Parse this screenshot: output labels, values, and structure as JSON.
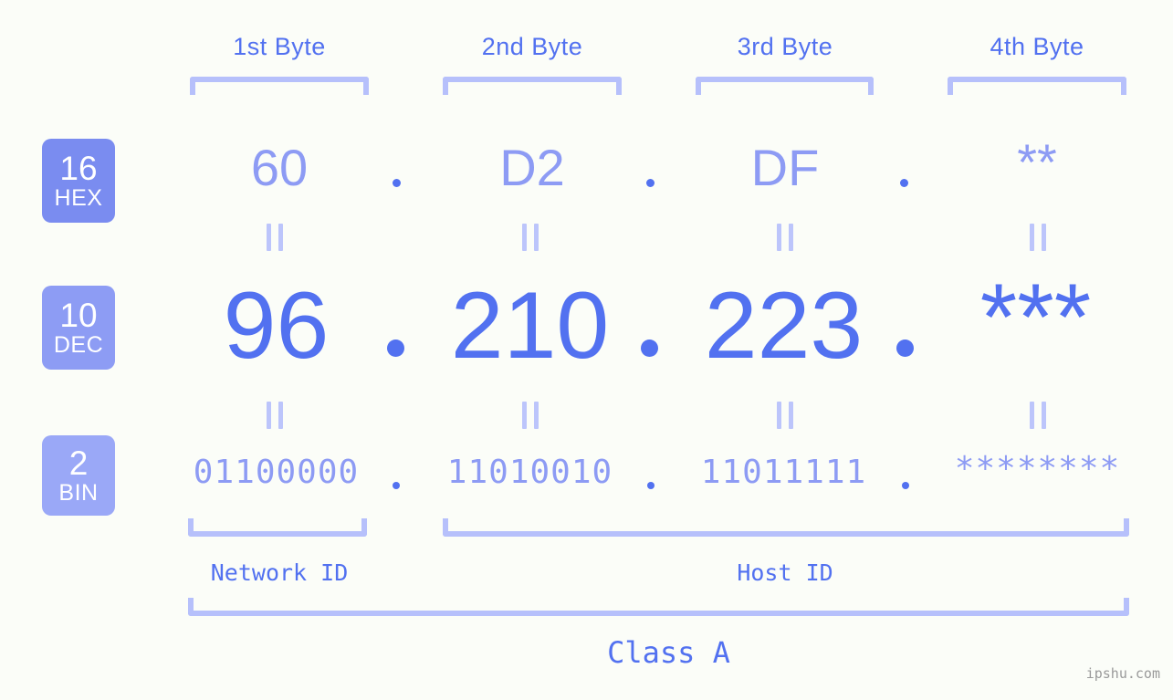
{
  "meta": {
    "watermark": "ipshu.com",
    "background_color": "#fbfdf8",
    "accent_color": "#5271f0",
    "light_accent_color": "#8d9bf4",
    "bracket_color": "#b6c0fb"
  },
  "byte_headers": [
    {
      "label": "1st Byte"
    },
    {
      "label": "2nd Byte"
    },
    {
      "label": "3rd Byte"
    },
    {
      "label": "4th Byte"
    }
  ],
  "bases": [
    {
      "number": "16",
      "name": "HEX",
      "color": "#7a8cf0"
    },
    {
      "number": "10",
      "name": "DEC",
      "color": "#8d9cf4"
    },
    {
      "number": "2",
      "name": "BIN",
      "color": "#9aa8f7"
    }
  ],
  "rows": {
    "hex": {
      "base_number": "16",
      "base_name": "HEX",
      "values": [
        "60",
        "D2",
        "DF",
        "**"
      ],
      "separator": "."
    },
    "dec": {
      "base_number": "10",
      "base_name": "DEC",
      "values": [
        "96",
        "210",
        "223",
        "***"
      ],
      "separator": "."
    },
    "bin": {
      "base_number": "2",
      "base_name": "BIN",
      "values": [
        "01100000",
        "11010010",
        "11011111",
        "********"
      ],
      "separator": "."
    }
  },
  "equivalence_symbol": "=",
  "segments": {
    "network_id": "Network ID",
    "host_id": "Host ID",
    "class": "Class A"
  }
}
